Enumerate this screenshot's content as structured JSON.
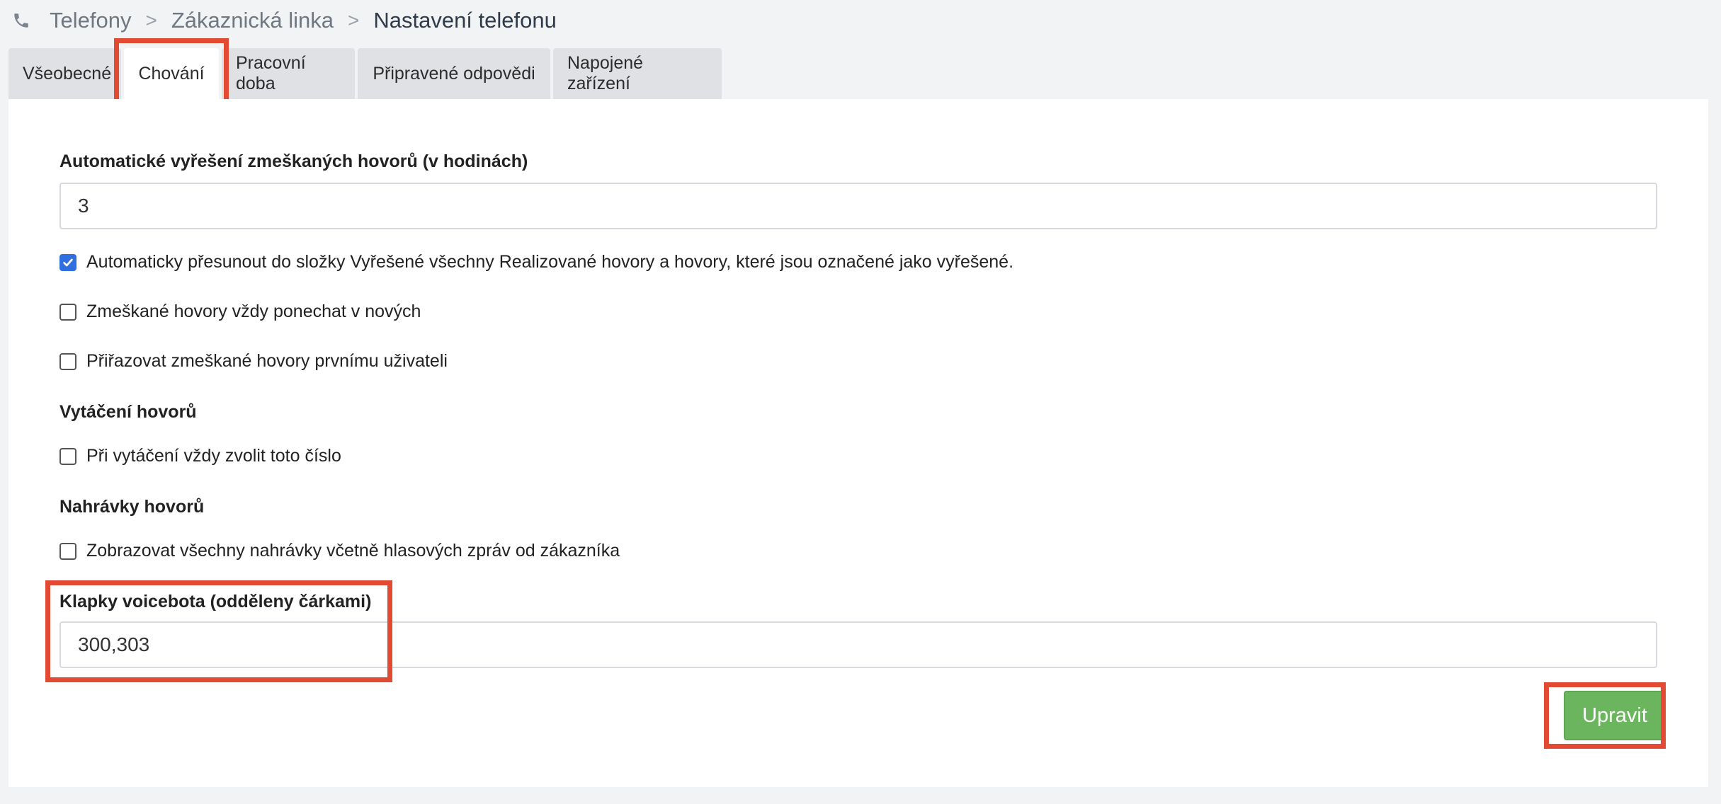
{
  "breadcrumb": {
    "icon": "phone-icon",
    "items": [
      "Telefony",
      "Zákaznická linka",
      "Nastavení telefonu"
    ],
    "separator": ">"
  },
  "tabs": [
    {
      "label": "Všeobecné",
      "active": false
    },
    {
      "label": "Chování",
      "active": true
    },
    {
      "label": "Pracovní doba",
      "active": false
    },
    {
      "label": "Připravené odpovědi",
      "active": false
    },
    {
      "label": "Napojené zařízení",
      "active": false
    }
  ],
  "form": {
    "auto_resolve": {
      "label": "Automatické vyřešení zmeškaných hovorů (v hodinách)",
      "value": "3"
    },
    "checkboxes": [
      {
        "label": "Automaticky přesunout do složky Vyřešené všechny Realizované hovory a hovory, které jsou označené jako vyřešené.",
        "checked": true
      },
      {
        "label": "Zmeškané hovory vždy ponechat v nových",
        "checked": false
      },
      {
        "label": "Přiřazovat zmeškané hovory prvnímu uživateli",
        "checked": false
      }
    ],
    "dialing": {
      "title": "Vytáčení hovorů",
      "checkbox": {
        "label": "Při vytáčení vždy zvolit toto číslo",
        "checked": false
      }
    },
    "recordings": {
      "title": "Nahrávky hovorů",
      "checkbox": {
        "label": "Zobrazovat všechny nahrávky včetně hlasových zpráv od zákazníka",
        "checked": false
      }
    },
    "voicebot": {
      "label": "Klapky voicebota (odděleny čárkami)",
      "value": "300,303"
    },
    "submit_label": "Upravit"
  },
  "colors": {
    "highlight": "#e24a33",
    "submit": "#6bb55e",
    "checkbox_checked": "#2f6fe0"
  }
}
